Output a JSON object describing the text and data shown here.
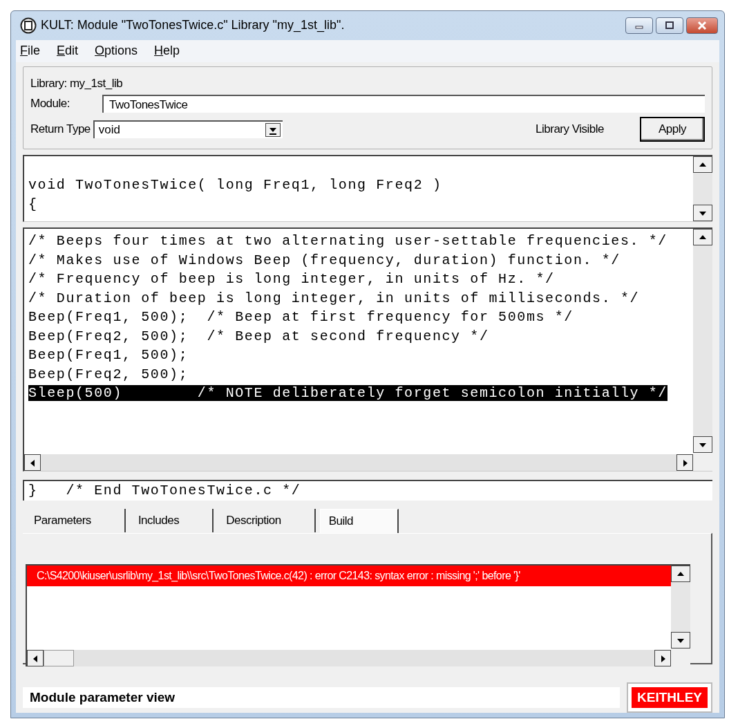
{
  "window": {
    "title": "KULT: Module \"TwoTonesTwice.c\" Library \"my_1st_lib\"."
  },
  "menu": [
    "File",
    "Edit",
    "Options",
    "Help"
  ],
  "header": {
    "library_label": "Library: my_1st_lib",
    "module_label": "Module:",
    "module_value": "TwoTonesTwice",
    "return_type_label": "Return Type",
    "return_type_value": "void",
    "library_visible": "Library Visible",
    "apply_button": "Apply"
  },
  "prototype_lines": [
    "void TwoTonesTwice( long Freq1, long Freq2 )",
    "{"
  ],
  "code_lines": [
    {
      "text": "/* Beeps four times at two alternating user-settable frequencies. */",
      "selected": false
    },
    {
      "text": "/* Makes use of Windows Beep (frequency, duration) function. */",
      "selected": false
    },
    {
      "text": "/* Frequency of beep is long integer, in units of Hz. */",
      "selected": false
    },
    {
      "text": "/* Duration of beep is long integer, in units of milliseconds. */",
      "selected": false
    },
    {
      "text": "Beep(Freq1, 500);  /* Beep at first frequency for 500ms */",
      "selected": false
    },
    {
      "text": "Beep(Freq2, 500);  /* Beep at second frequency */",
      "selected": false
    },
    {
      "text": "Beep(Freq1, 500);",
      "selected": false
    },
    {
      "text": "Beep(Freq2, 500);",
      "selected": false
    },
    {
      "text": "Sleep(500)        /* NOTE deliberately forget semicolon initially */",
      "selected": true
    }
  ],
  "footer_line": "}   /* End TwoTonesTwice.c */",
  "tabs": [
    {
      "label": "Parameters",
      "selected": false
    },
    {
      "label": "Includes",
      "selected": false
    },
    {
      "label": "Description",
      "selected": false
    },
    {
      "label": "Build",
      "selected": true
    }
  ],
  "build_messages": [
    {
      "text": "C:\\S4200\\kiuser\\usrlib\\my_1st_lib\\\\src\\TwoTonesTwice.c(42) : error C2143: syntax error : missing ';' before '}'",
      "selected": true
    }
  ],
  "status_bar": {
    "text": "Module parameter view",
    "logo": "KEITHLEY"
  }
}
